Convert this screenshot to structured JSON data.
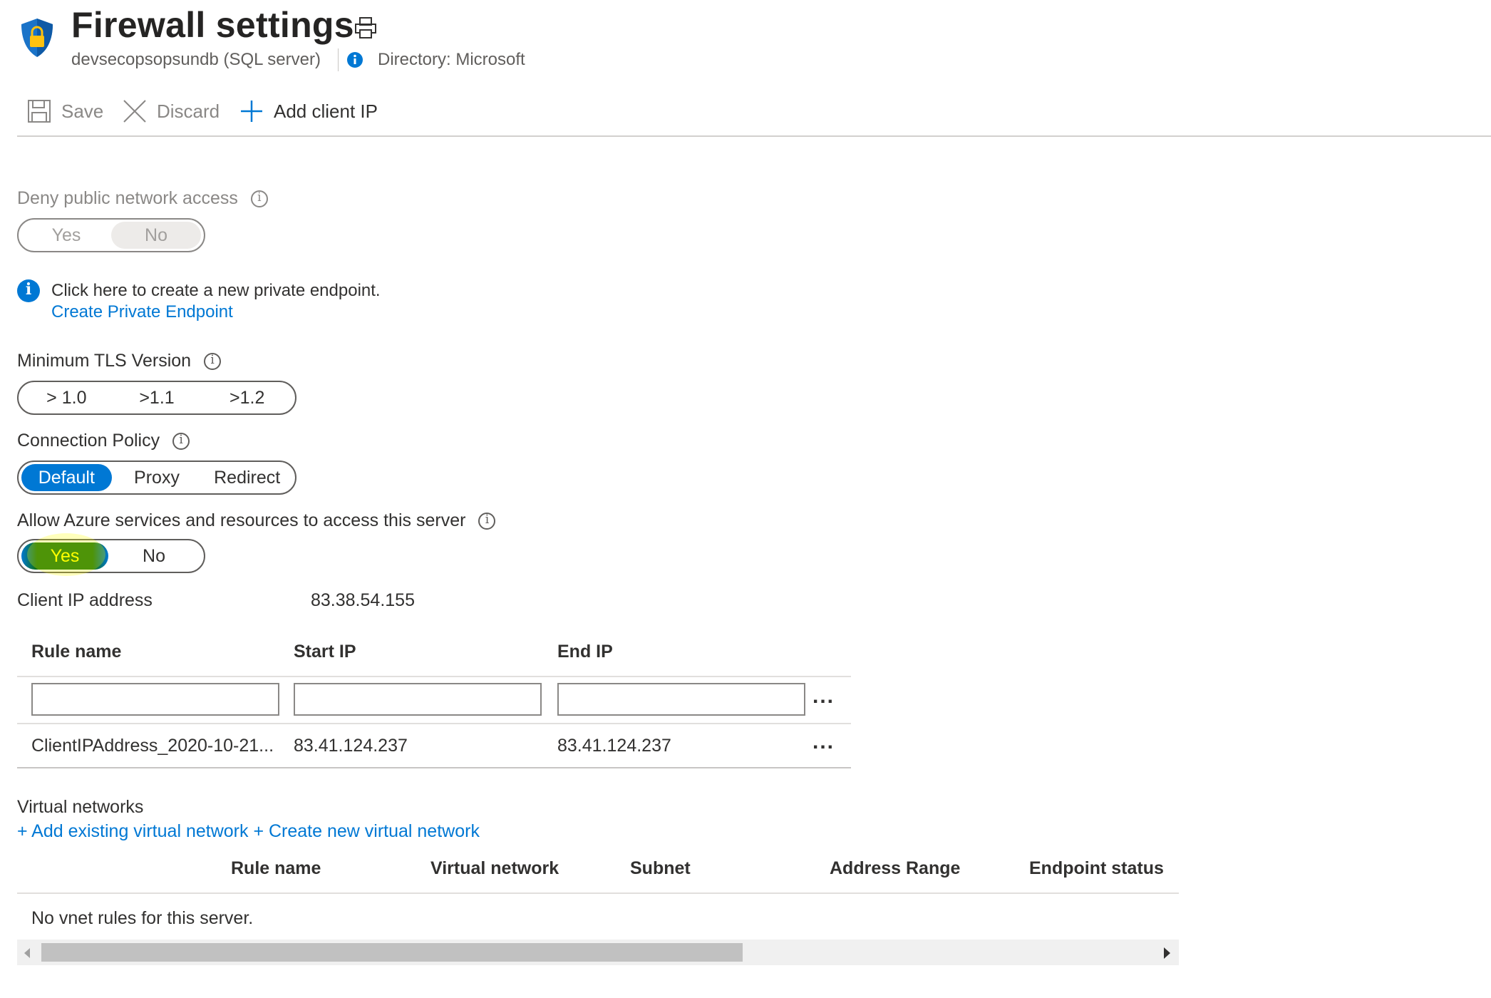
{
  "header": {
    "title": "Firewall settings",
    "subtitle": "devsecopsopsundb (SQL server)",
    "directory": "Directory: Microsoft",
    "icons": [
      "shield-lock-icon",
      "print-icon",
      "info-icon"
    ]
  },
  "toolbar": {
    "save_label": "Save",
    "discard_label": "Discard",
    "add_client_ip_label": "Add client IP"
  },
  "deny_public": {
    "label": "Deny public network access",
    "yes": "Yes",
    "no": "No",
    "selected": "No",
    "disabled": true
  },
  "private_endpoint": {
    "text": "Click here to create a new private endpoint.",
    "link": "Create Private Endpoint"
  },
  "tls": {
    "label": "Minimum TLS Version",
    "options": [
      "> 1.0",
      ">1.1",
      ">1.2"
    ]
  },
  "connection_policy": {
    "label": "Connection Policy",
    "options": [
      "Default",
      "Proxy",
      "Redirect"
    ],
    "selected": "Default"
  },
  "allow_azure": {
    "label": "Allow Azure services and resources to access this server",
    "yes": "Yes",
    "no": "No",
    "selected": "Yes"
  },
  "client_ip": {
    "label": "Client IP address",
    "value": "83.38.54.155"
  },
  "firewall_rules": {
    "columns": [
      "Rule name",
      "Start IP",
      "End IP"
    ],
    "new_row": {
      "rule_name": "",
      "start_ip": "",
      "end_ip": ""
    },
    "rows": [
      {
        "rule_name": "ClientIPAddress_2020-10-21...",
        "start_ip": "83.41.124.237",
        "end_ip": "83.41.124.237"
      }
    ],
    "more_actions": "..."
  },
  "virtual_networks": {
    "title": "Virtual networks",
    "add_existing": "+ Add existing virtual network",
    "create_new": "+ Create new virtual network",
    "columns": [
      "Rule name",
      "Virtual network",
      "Subnet",
      "Address Range",
      "Endpoint status"
    ],
    "empty_text": "No vnet rules for this server."
  },
  "colors": {
    "accent": "#0078d4",
    "highlight": "#ffff00",
    "text": "#323130",
    "disabled_text": "#8a8886"
  }
}
